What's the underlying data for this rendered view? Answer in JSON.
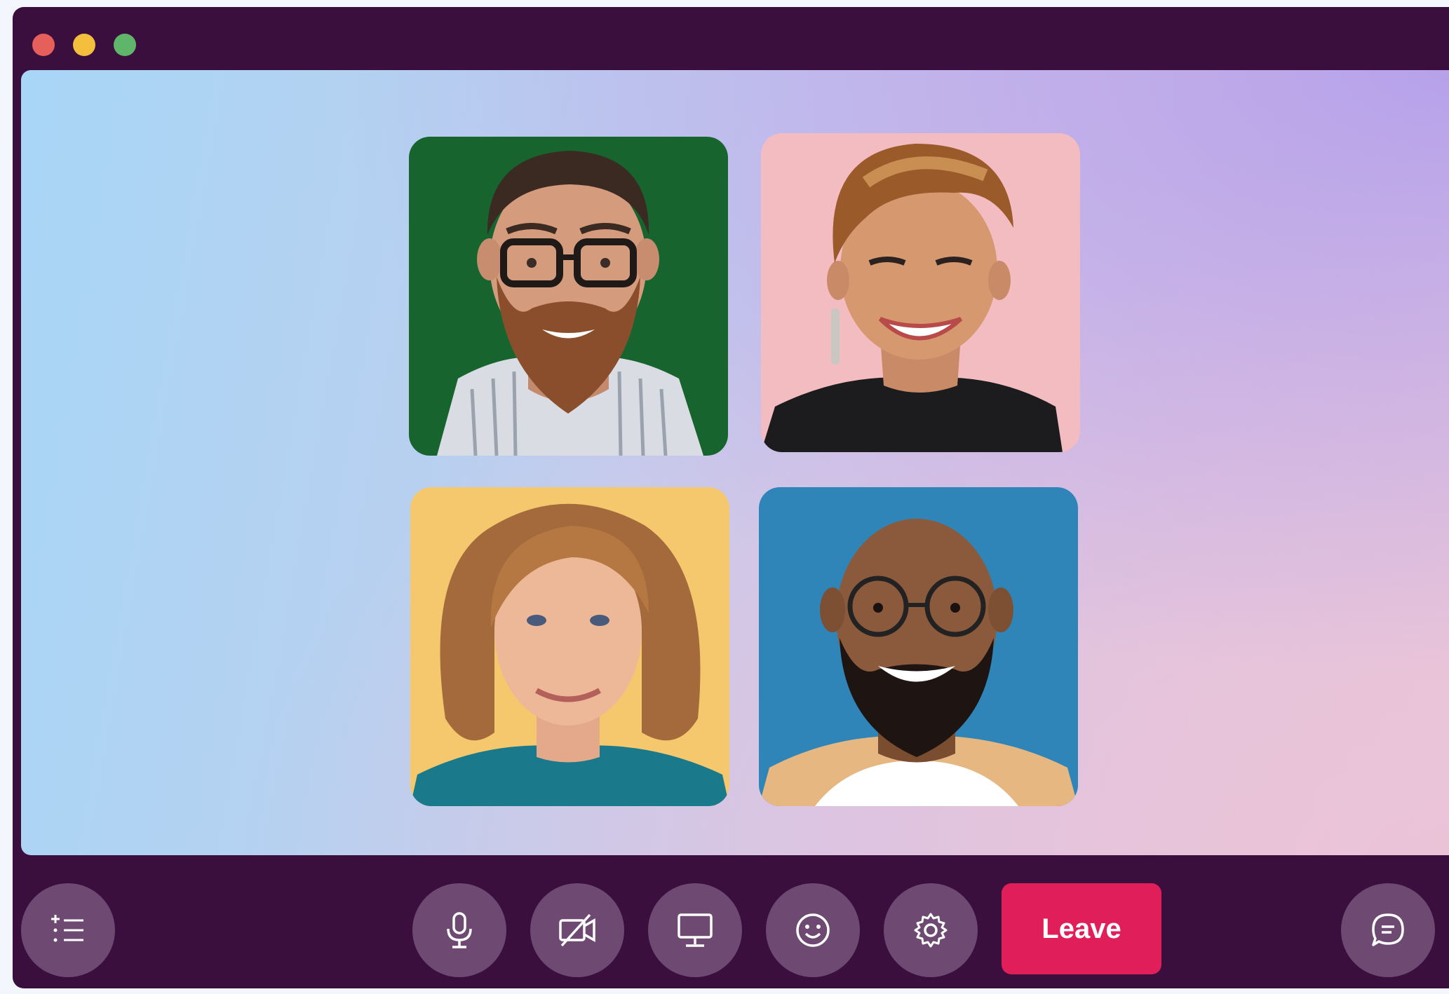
{
  "window": {
    "controls": [
      {
        "name": "close",
        "color": "#e5605b"
      },
      {
        "name": "minimize",
        "color": "#f3bf3c"
      },
      {
        "name": "zoom",
        "color": "#5fb56a"
      }
    ]
  },
  "participants": [
    {
      "position": "top-left",
      "background": "#17642e",
      "description_icon": "person-avatar"
    },
    {
      "position": "top-right",
      "background": "#f2bcc0",
      "description_icon": "person-avatar"
    },
    {
      "position": "bottom-left",
      "background": "#f5c86e",
      "description_icon": "person-avatar"
    },
    {
      "position": "bottom-right",
      "background": "#2f85b8",
      "description_icon": "person-avatar"
    }
  ],
  "toolbar": {
    "left_button_icon": "list-add-icon",
    "buttons": [
      {
        "name": "microphone",
        "icon": "microphone-icon"
      },
      {
        "name": "video",
        "icon": "video-off-icon"
      },
      {
        "name": "share-screen",
        "icon": "monitor-icon"
      },
      {
        "name": "reactions",
        "icon": "smiley-icon"
      },
      {
        "name": "settings",
        "icon": "gear-icon"
      }
    ],
    "leave_label": "Leave",
    "leave_color": "#e01e5a",
    "right_button_icon": "chat-icon"
  },
  "colors": {
    "chrome": "#3a0f3d",
    "button": "#6e4a73"
  }
}
